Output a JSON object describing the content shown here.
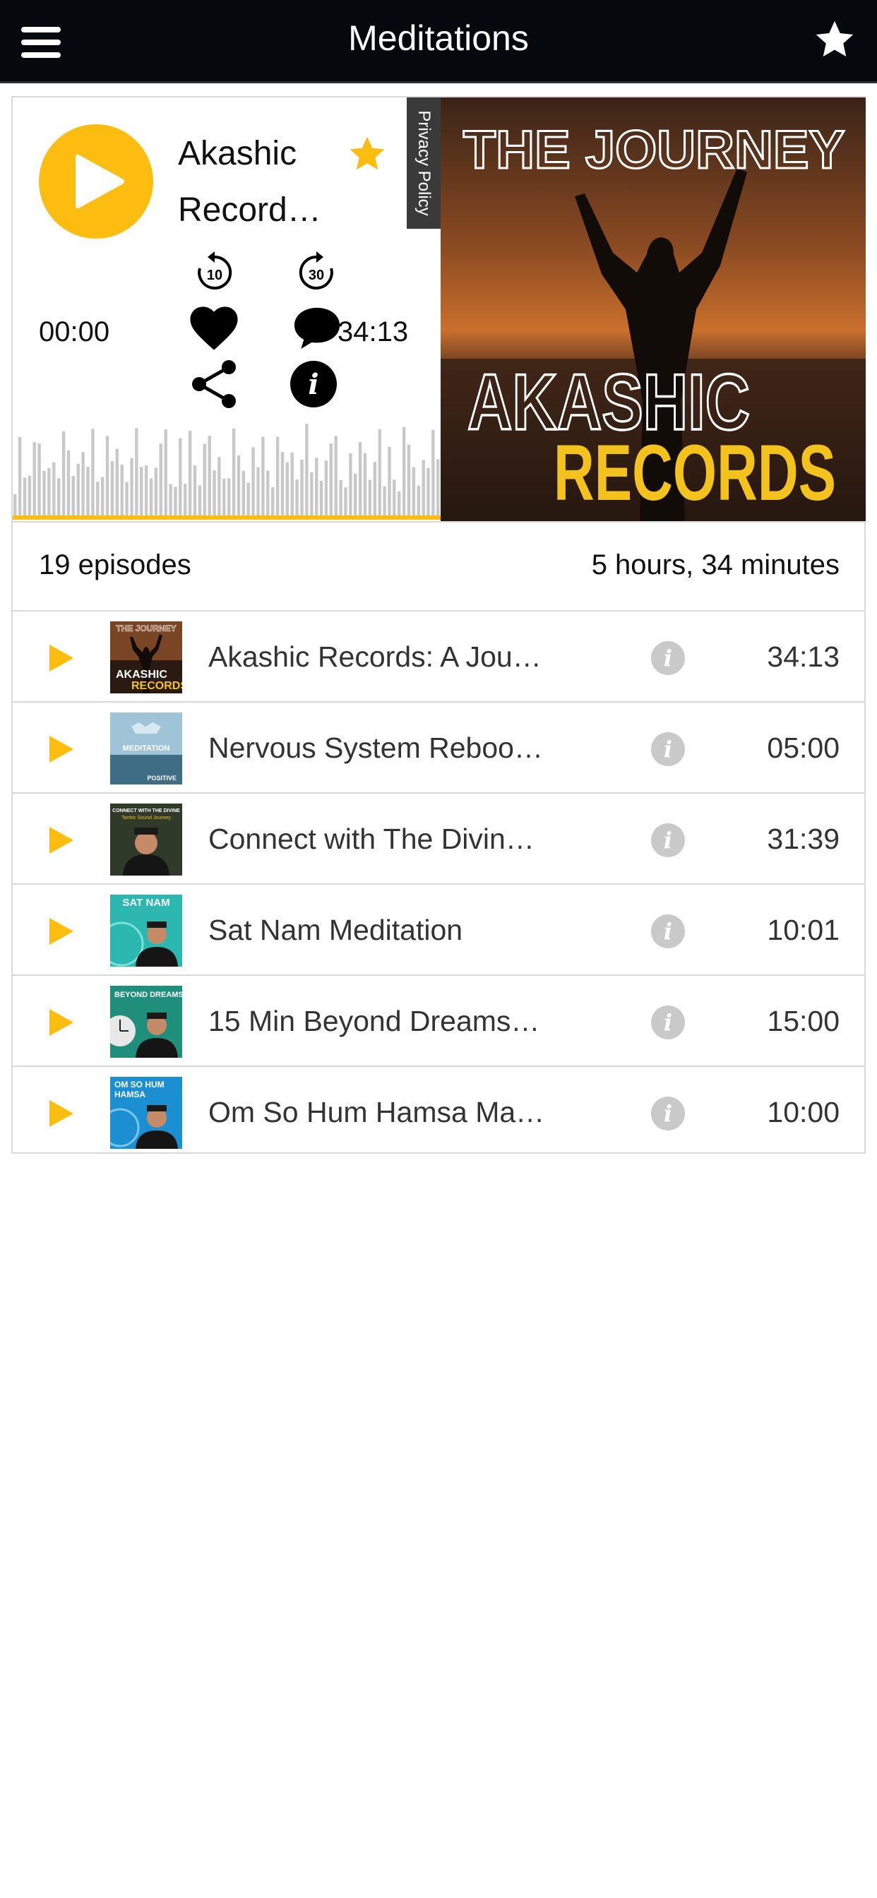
{
  "header": {
    "title": "Meditations"
  },
  "player": {
    "track_title": "Akashic Record…",
    "privacy_label": "Privacy Policy",
    "rewind_label": "10",
    "forward_label": "30",
    "elapsed": "00:00",
    "total": "34:13",
    "info_glyph": "i",
    "cover": {
      "line1": "THE JOURNEY",
      "line2": "AKASHIC",
      "line3": "RECORDS"
    }
  },
  "summary": {
    "episodes": "19 episodes",
    "duration": "5 hours, 34 minutes"
  },
  "episodes": [
    {
      "title": "Akashic Records: A Jou…",
      "duration": "34:13"
    },
    {
      "title": "Nervous System Reboo…",
      "duration": "05:00"
    },
    {
      "title": "Connect with The Divin…",
      "duration": "31:39"
    },
    {
      "title": "Sat Nam Meditation",
      "duration": "10:01"
    },
    {
      "title": "15 Min Beyond Dreams…",
      "duration": "15:00"
    },
    {
      "title": "Om So Hum Hamsa Ma…",
      "duration": "10:00"
    }
  ],
  "thumbnails": [
    {
      "line1": "THE JOURNEY",
      "line2": "AKASHIC",
      "line3": "RECORDS"
    },
    {
      "line1": "MEDITATION",
      "line2": "POSITIVE"
    },
    {
      "line1": "CONNECT WITH THE DIVINE",
      "line2": "Tantric Sound Journey"
    },
    {
      "line1": "SAT NAM"
    },
    {
      "line1": "BEYOND DREAMS"
    },
    {
      "line1": "OM SO HUM",
      "line2": "HAMSA"
    }
  ],
  "icons": {
    "menu": "hamburger-icon",
    "header_star": "star-icon",
    "fav_star": "star-icon",
    "rewind": "rewind-10-icon",
    "forward": "forward-30-icon",
    "like": "heart-icon",
    "comment": "comment-icon",
    "share": "share-icon",
    "info": "info-icon",
    "episode_play": "play-icon",
    "episode_info": "info-icon"
  },
  "colors": {
    "accent": "#fdbd10",
    "topbar": "#05080c",
    "divider": "#d9d9d9",
    "info_gray": "#c9c9c9"
  }
}
